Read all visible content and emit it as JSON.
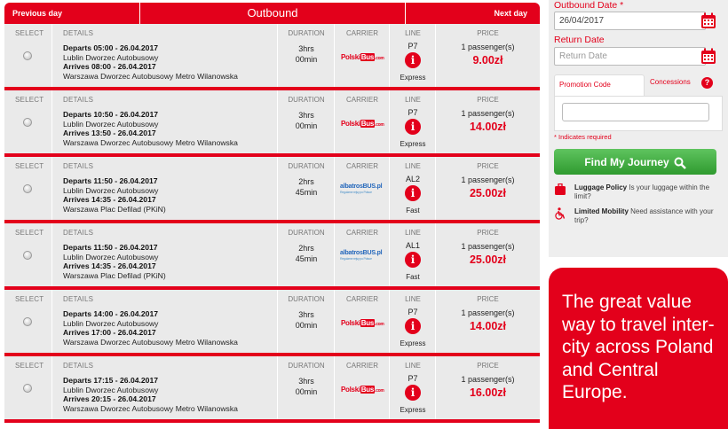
{
  "header": {
    "prev_label": "Previous day",
    "title": "Outbound",
    "next_label": "Next day"
  },
  "columns": {
    "select": "SELECT",
    "details": "DETAILS",
    "duration": "DURATION",
    "carrier": "CARRIER",
    "line": "LINE",
    "price": "PRICE"
  },
  "journeys": [
    {
      "departs": "Departs 05:00 - 26.04.2017",
      "from": "Lublin Dworzec Autobusowy",
      "arrives": "Arrives 08:00 - 26.04.2017",
      "to": "Warszawa Dworzec Autobusowy Metro Wilanowska",
      "dur_h": "3hrs",
      "dur_m": "00min",
      "carrier": "polskibus",
      "line": "P7",
      "line_type": "Express",
      "passengers": "1 passenger(s)",
      "price": "9.00zł"
    },
    {
      "departs": "Departs 10:50 - 26.04.2017",
      "from": "Lublin Dworzec Autobusowy",
      "arrives": "Arrives 13:50 - 26.04.2017",
      "to": "Warszawa Dworzec Autobusowy Metro Wilanowska",
      "dur_h": "3hrs",
      "dur_m": "00min",
      "carrier": "polskibus",
      "line": "P7",
      "line_type": "Express",
      "passengers": "1 passenger(s)",
      "price": "14.00zł"
    },
    {
      "departs": "Departs 11:50 - 26.04.2017",
      "from": "Lublin Dworzec Autobusowy",
      "arrives": "Arrives 14:35 - 26.04.2017",
      "to": "Warszawa Plac Defilad (PKiN)",
      "dur_h": "2hrs",
      "dur_m": "45min",
      "carrier": "albatrosbus",
      "line": "AL2",
      "line_type": "Fast",
      "passengers": "1 passenger(s)",
      "price": "25.00zł"
    },
    {
      "departs": "Departs 11:50 - 26.04.2017",
      "from": "Lublin Dworzec Autobusowy",
      "arrives": "Arrives 14:35 - 26.04.2017",
      "to": "Warszawa Plac Defilad (PKiN)",
      "dur_h": "2hrs",
      "dur_m": "45min",
      "carrier": "albatrosbus",
      "line": "AL1",
      "line_type": "Fast",
      "passengers": "1 passenger(s)",
      "price": "25.00zł"
    },
    {
      "departs": "Departs 14:00 - 26.04.2017",
      "from": "Lublin Dworzec Autobusowy",
      "arrives": "Arrives 17:00 - 26.04.2017",
      "to": "Warszawa Dworzec Autobusowy Metro Wilanowska",
      "dur_h": "3hrs",
      "dur_m": "00min",
      "carrier": "polskibus",
      "line": "P7",
      "line_type": "Express",
      "passengers": "1 passenger(s)",
      "price": "14.00zł"
    },
    {
      "departs": "Departs 17:15 - 26.04.2017",
      "from": "Lublin Dworzec Autobusowy",
      "arrives": "Arrives 20:15 - 26.04.2017",
      "to": "Warszawa Dworzec Autobusowy Metro Wilanowska",
      "dur_h": "3hrs",
      "dur_m": "00min",
      "carrier": "polskibus",
      "line": "P7",
      "line_type": "Express",
      "passengers": "1 passenger(s)",
      "price": "16.00zł"
    }
  ],
  "logos": {
    "polskibus_a": "Polski",
    "polskibus_b": "Bus",
    "polskibus_c": ".com",
    "albatros_a": "albatros",
    "albatros_b": "BUS",
    "albatros_c": ".pl",
    "albatros_sub": "Regularne rejsy po Polsce"
  },
  "info_glyph": "i",
  "search": {
    "outbound_label": "Outbound Date *",
    "outbound_value": "26/04/2017",
    "return_label": "Return Date",
    "return_placeholder": "Return Date",
    "promo_tab": "Promotion Code",
    "concessions_tab": "Concessions",
    "help_glyph": "?",
    "required_note": "* Indicates required",
    "find_button": "Find My Journey",
    "luggage_title": "Luggage Policy",
    "luggage_text": "Is your luggage within the limit?",
    "mobility_title": "Limited Mobility",
    "mobility_text": "Need assistance with your trip?"
  },
  "promo_banner": "The great value way to travel inter-city across Poland and Central Europe.",
  "colors": {
    "brand_red": "#e3001b",
    "row_bg": "#eaeaea",
    "button_green": "#2f9a2f"
  },
  "icons": [
    "calendar-icon",
    "info-icon",
    "help-icon",
    "search-icon",
    "luggage-icon",
    "wheelchair-icon",
    "radio-icon"
  ]
}
